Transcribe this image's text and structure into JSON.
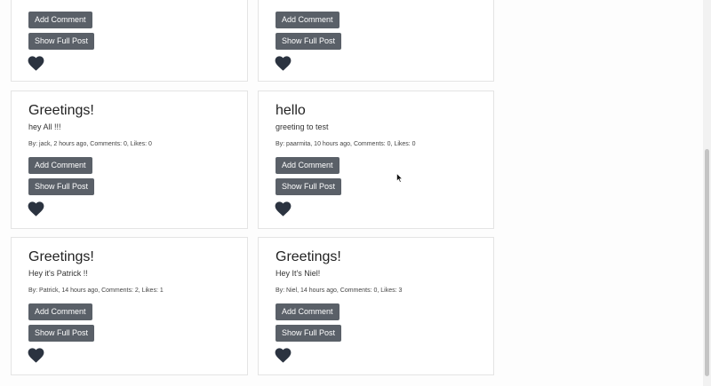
{
  "buttons": {
    "add_comment": "Add Comment",
    "show_full_post": "Show Full Post"
  },
  "icons": {
    "like": "heart-icon"
  },
  "colors": {
    "button_bg": "#5a6068",
    "heart": "#2b3340"
  },
  "posts": [
    {
      "title": "Greetings!",
      "body": "hey All !!!",
      "meta": "By: jack, 2 hours ago, Comments: 0, Likes: 0"
    },
    {
      "title": "hello",
      "body": "greeting to test",
      "meta": "By: paarmita, 10 hours ago, Comments: 0, Likes: 0"
    },
    {
      "title": "Greetings!",
      "body": "Hey it's Patrick !!",
      "meta": "By: Patrick, 14 hours ago, Comments: 2, Likes: 1"
    },
    {
      "title": "Greetings!",
      "body": "Hey It's Niel!",
      "meta": "By: Niel, 14 hours ago, Comments: 0, Likes: 3"
    }
  ]
}
